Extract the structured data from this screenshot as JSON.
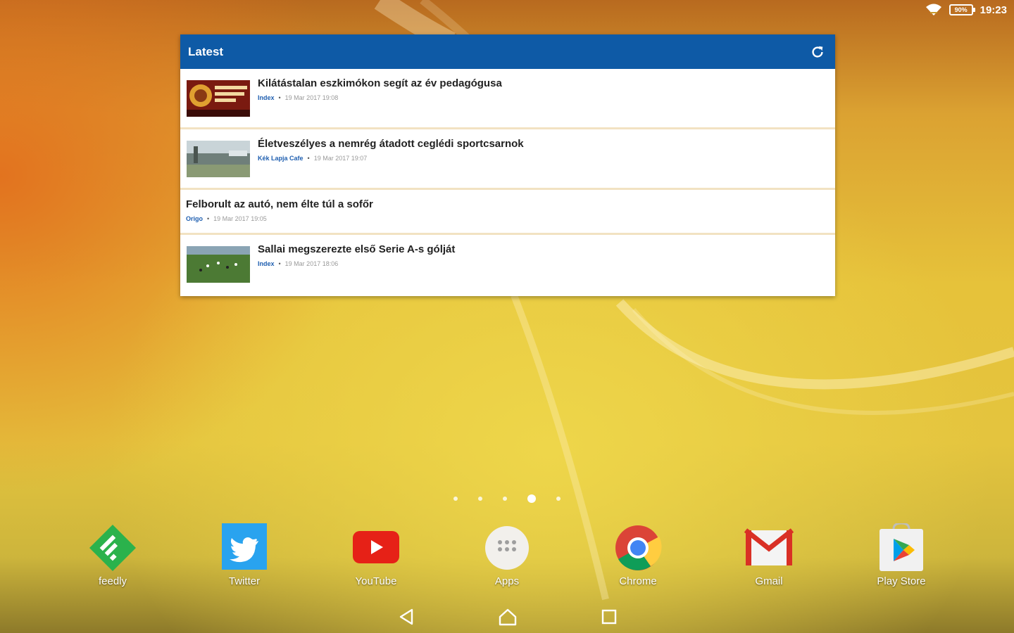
{
  "status_bar": {
    "time": "19:23",
    "battery_pct": "90%",
    "wifi_icon": "wifi-icon",
    "battery_icon": "battery-icon"
  },
  "widget": {
    "title": "Latest",
    "refresh_icon": "refresh-icon",
    "header_color": "#0e5aa6",
    "items": [
      {
        "title": "Kilátástalan eszkimókon segít az év pedagógusa",
        "source": "Index",
        "separator": "•",
        "time": "19 Mar 2017 19:08",
        "has_thumb": true
      },
      {
        "title": "Életveszélyes a nemrég átadott ceglédi sportcsarnok",
        "source": "Kék Lapja Cafe",
        "separator": "•",
        "time": "19 Mar 2017 19:07",
        "has_thumb": true
      },
      {
        "title": "Felborult az autó, nem élte túl a sofőr",
        "source": "Origo",
        "separator": "•",
        "time": "19 Mar 2017 19:05",
        "has_thumb": false
      },
      {
        "title": "Sallai megszerezte első Serie A-s gólját",
        "source": "Index",
        "separator": "•",
        "time": "19 Mar 2017 18:06",
        "has_thumb": true
      }
    ]
  },
  "page_indicator": {
    "count": 5,
    "active_index": 3
  },
  "dock": [
    {
      "label": "feedly",
      "icon": "feedly-icon"
    },
    {
      "label": "Twitter",
      "icon": "twitter-icon"
    },
    {
      "label": "YouTube",
      "icon": "youtube-icon"
    },
    {
      "label": "Apps",
      "icon": "apps-grid-icon"
    },
    {
      "label": "Chrome",
      "icon": "chrome-icon"
    },
    {
      "label": "Gmail",
      "icon": "gmail-icon"
    },
    {
      "label": "Play Store",
      "icon": "play-store-icon"
    }
  ],
  "nav_bar": {
    "back_icon": "back-icon",
    "home_icon": "home-icon",
    "recents_icon": "recents-icon"
  }
}
